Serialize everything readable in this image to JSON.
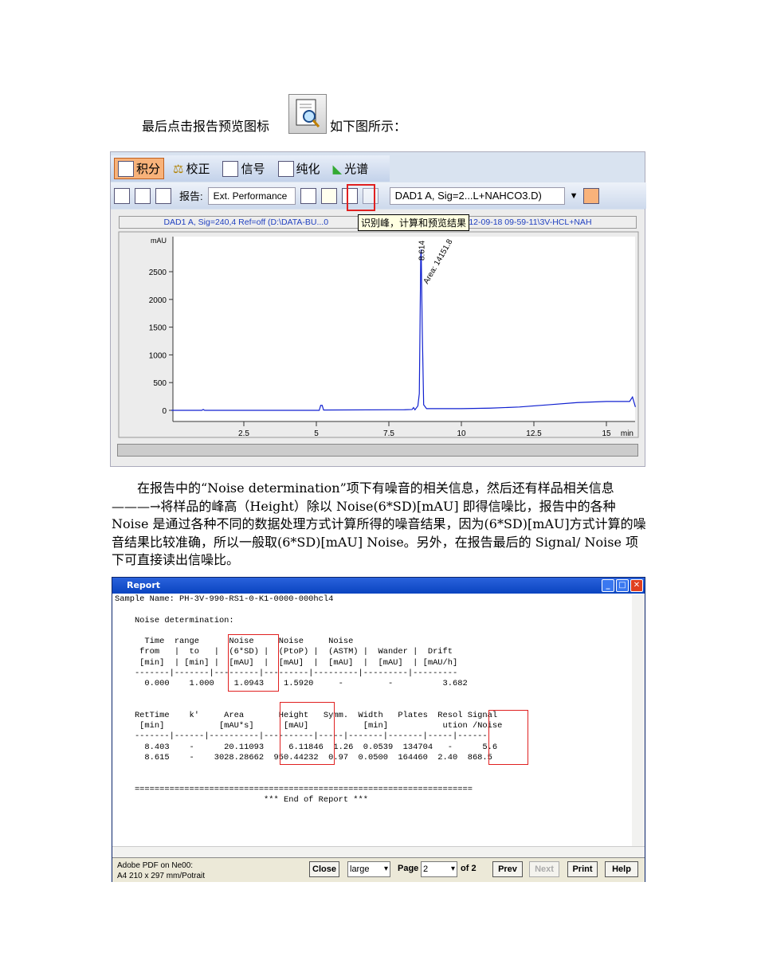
{
  "paragraph1": {
    "before": "最后点击报告预览图标",
    "after": "，如下图所示："
  },
  "app": {
    "tabs": [
      {
        "label": "积分",
        "active": true
      },
      {
        "label": "校正"
      },
      {
        "label": "信号"
      },
      {
        "label": "纯化"
      },
      {
        "label": "光谱"
      }
    ],
    "report_label": "报告:",
    "report_combo": "Ext. Performance",
    "signal_combo": "DAD1 A, Sig=2...L+NAHCO3.D)",
    "signal_title_left": "DAD1 A, Sig=240,4 Ref=off (D:\\DATA-BU...0",
    "signal_title_right": "08 2012-09-18 09-59-11\\3V-HCL+NAH",
    "tooltip": "识别峰，计算和预览结果"
  },
  "chart_data": {
    "type": "line",
    "ylabel": "mAU",
    "xlabel": "min",
    "xlim": [
      0,
      16
    ],
    "ylim": [
      -200,
      3000
    ],
    "xticks": [
      2.5,
      5,
      7.5,
      10,
      12.5,
      15
    ],
    "yticks": [
      0,
      500,
      1000,
      1500,
      2000,
      2500
    ],
    "peak_label": "8.614",
    "area_label": "Area: 14151.8",
    "series": [
      {
        "name": "DAD1 A",
        "color": "#1020d0",
        "x": [
          0,
          0.3,
          1.05,
          1.1,
          1.15,
          5.1,
          5.15,
          5.2,
          5.25,
          7.5,
          8.0,
          8.3,
          8.35,
          8.4,
          8.5,
          8.55,
          8.6,
          8.614,
          8.65,
          8.7,
          8.8,
          10,
          11,
          12,
          13,
          14,
          15,
          15.8,
          15.9,
          16
        ],
        "y": [
          0,
          0,
          0,
          15,
          0,
          0,
          90,
          90,
          5,
          10,
          10,
          15,
          50,
          10,
          80,
          300,
          2800,
          2900,
          1500,
          100,
          30,
          30,
          40,
          60,
          100,
          140,
          160,
          160,
          240,
          60
        ]
      }
    ]
  },
  "paragraph2": "在报告中的“Noise determination”项下有噪音的相关信息，然后还有样品相关信息———→将样品的峰高（Height）除以 Noise(6*SD)[mAU] 即得信噪比，报告中的各种 Noise 是通过各种不同的数据处理方式计算所得的噪音结果，因为(6*SD)[mAU]方式计算的噪音结果比较准确，所以一般取(6*SD)[mAU] Noise。另外，在报告最后的 Signal/ Noise 项下可直接读出信噪比。",
  "report": {
    "title": "Report",
    "lines": [
      "Sample Name: PH-3V-990-RS1-0-K1-0000-000hcl4",
      "",
      "    Noise determination:",
      "",
      "      Time  range      Noise     Noise     Noise",
      "     from   |  to   |  (6*SD) |  (PtoP) |  (ASTM) |  Wander |  Drift",
      "     [min]  | [min] |  [mAU]  |  [mAU]  |  [mAU]  |  [mAU]  | [mAU/h]",
      "    -------|-------|---------|---------|---------|---------|---------",
      "      0.000    1.000    1.0943    1.5920     -         -          3.682",
      "",
      "",
      "    RetTime    k'     Area       Height   Symm.  Width   Plates  Resol Signal",
      "     [min]           [mAU*s]      [mAU]           [min]           ution /Noise",
      "    -------|------|----------|----------|-----|-------|-------|-----|------",
      "      8.403    -      20.11093     6.11846  1.26  0.0539  134704   -      5.6",
      "      8.615    -    3028.28662  950.44232  0.97  0.0500  164460  2.40  868.5",
      "",
      "",
      "    ====================================================================",
      "                              *** End of Report ***"
    ],
    "printer": "Adobe PDF on Ne00:",
    "paper": "A4 210 x 297 mm/Potrait",
    "close": "Close",
    "zoom": "large",
    "page_label": "Page",
    "page": "2",
    "of": "of 2",
    "prev": "Prev",
    "next": "Next",
    "print": "Print",
    "help": "Help"
  }
}
